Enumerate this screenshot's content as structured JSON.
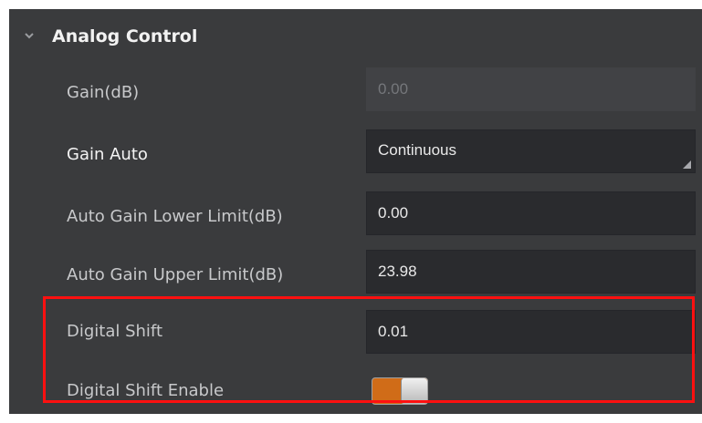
{
  "section": {
    "title": "Analog Control",
    "expanded": true
  },
  "params": [
    {
      "label": "Gain(dB)",
      "value": "0.00",
      "state": "disabled"
    },
    {
      "label": "Gain Auto",
      "value": "Continuous",
      "state": "dropdown"
    },
    {
      "label": "Auto Gain Lower Limit(dB)",
      "value": "0.00",
      "state": "enabled"
    },
    {
      "label": "Auto Gain Upper Limit(dB)",
      "value": "23.98",
      "state": "enabled"
    },
    {
      "label": "Digital Shift",
      "value": "0.01",
      "state": "enabled"
    },
    {
      "label": "Digital Shift Enable",
      "value": "",
      "state": "toggle"
    }
  ],
  "toggle": {
    "on": true,
    "on_color": "#d06c18"
  },
  "highlight": {
    "color": "#ff1010"
  }
}
